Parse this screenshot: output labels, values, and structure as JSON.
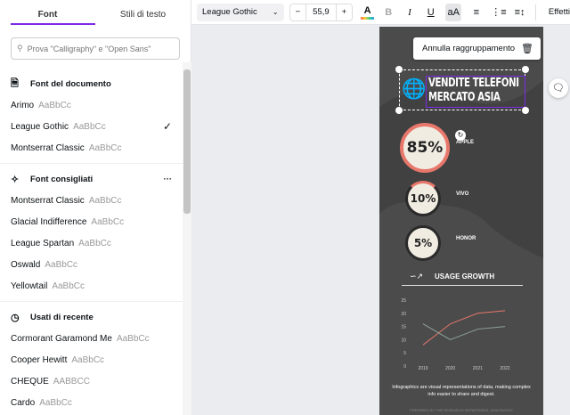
{
  "left_panel": {
    "tabs": [
      "Font",
      "Stili di testo"
    ],
    "search_placeholder": "Prova \"Calligraphy\" e \"Open Sans\"",
    "sections": [
      {
        "title": "Font del documento",
        "icon": "document-icon",
        "items": [
          {
            "name": "Arimo",
            "sample": "AaBbCc"
          },
          {
            "name": "League Gothic",
            "sample": "AaBbCc",
            "selected": true
          },
          {
            "name": "Montserrat Classic",
            "sample": "AaBbCc"
          }
        ]
      },
      {
        "title": "Font consigliati",
        "icon": "sparkle-icon",
        "more": "···",
        "items": [
          {
            "name": "Montserrat Classic",
            "sample": "AaBbCc"
          },
          {
            "name": "Glacial Indifference",
            "sample": "AaBbCc"
          },
          {
            "name": "League Spartan",
            "sample": "AaBbCc"
          },
          {
            "name": "Oswald",
            "sample": "AaBbCc"
          },
          {
            "name": "Yellowtail",
            "sample": "AaBbCc"
          }
        ]
      },
      {
        "title": "Usati di recente",
        "icon": "clock-icon",
        "items": [
          {
            "name": "Cormorant Garamond Me",
            "sample": "AaBbCc"
          },
          {
            "name": "Cooper Hewitt",
            "sample": "AaBbCc"
          },
          {
            "name": "CHEQUE",
            "sample": "AABBCC"
          },
          {
            "name": "Cardo",
            "sample": "AaBbCc"
          }
        ]
      }
    ]
  },
  "toolbar": {
    "font": "League Gothic",
    "size": "55,9",
    "minus": "−",
    "plus": "+",
    "bold": "B",
    "italic": "I",
    "underline": "U",
    "case": "aA",
    "effects": "Effetti"
  },
  "popup": {
    "ungroup": "Annulla raggruppamento"
  },
  "infographic": {
    "title_line1": "VENDITE TELEFONI",
    "title_line2": "MERCATO ASIA",
    "stats": [
      {
        "value": "85%",
        "label": "APPLE",
        "percent": 85
      },
      {
        "value": "10%",
        "label": "VIVO",
        "percent": 10
      },
      {
        "value": "5%",
        "label": "HONOR",
        "percent": 5
      }
    ],
    "chart_heading": "USAGE GROWTH",
    "caption": "Infographics are visual representations of data, making complex info easier to share and digest.",
    "footer": "PREPARED BY THE RESEARCH DEPARTMENT, ASIA PACIFIC"
  },
  "chart_data": {
    "type": "line",
    "categories": [
      "2019",
      "2020",
      "2021",
      "2022"
    ],
    "yticks": [
      "0",
      "5",
      "10",
      "15",
      "20",
      "25"
    ],
    "ylim": [
      0,
      25
    ],
    "series": [
      {
        "name": "red",
        "color": "#e8776b",
        "values": [
          8,
          16,
          20,
          21
        ]
      },
      {
        "name": "gray",
        "color": "#8fa39a",
        "values": [
          16,
          10,
          14,
          15
        ]
      }
    ]
  }
}
